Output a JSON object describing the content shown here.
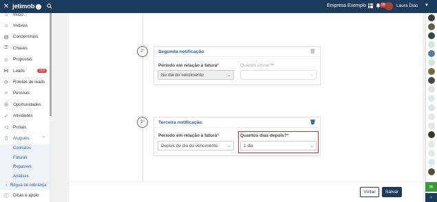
{
  "header": {
    "close_glyph": "✕",
    "brand": "jetimob",
    "company": "Empresa Exemplo",
    "notification_count": "99",
    "user_name": "Laura Dias",
    "colors": {
      "navy": "#1b3a5c",
      "accent": "#2a5aa8",
      "highlight": "#d32f2f"
    }
  },
  "sidebar": {
    "items": [
      {
        "label": "Início",
        "icon": "home-icon"
      },
      {
        "label": "Imóveis",
        "icon": "house-icon"
      },
      {
        "label": "Condomínios",
        "icon": "building-icon"
      },
      {
        "label": "Chaves",
        "icon": "key-icon"
      },
      {
        "label": "Propostas",
        "icon": "tag-icon"
      },
      {
        "label": "Leads",
        "icon": "share-icon",
        "badge": "319"
      },
      {
        "label": "Roletas de leads",
        "icon": "roulette-icon"
      },
      {
        "label": "Pessoas",
        "icon": "people-icon"
      },
      {
        "label": "Oportunidades",
        "icon": "target-icon"
      },
      {
        "label": "Atividades",
        "icon": "check-circle-icon"
      },
      {
        "label": "Portais",
        "icon": "megaphone-icon"
      },
      {
        "label": "Aluguéis",
        "icon": "book-icon"
      }
    ],
    "subitems": [
      "Contratos",
      "Faturas",
      "Repasses",
      "Análises"
    ],
    "regua": "Régua de cobrança",
    "help": "Dicas e apoio"
  },
  "second": {
    "step": "2°",
    "title": "Segunda notificação",
    "period_label": "Período em relação à fatura",
    "period_value": "No dia do vencimento",
    "when_label": "Quando enviar?"
  },
  "third": {
    "step": "3°",
    "title": "Terceira notificação",
    "period_label": "Período em relação à fatura",
    "period_value": "Depois do dia do vencimento",
    "days_label": "Quantos dias depois?",
    "days_value": "1 dia"
  },
  "footer": {
    "back": "Voltar",
    "save": "Salvar"
  }
}
